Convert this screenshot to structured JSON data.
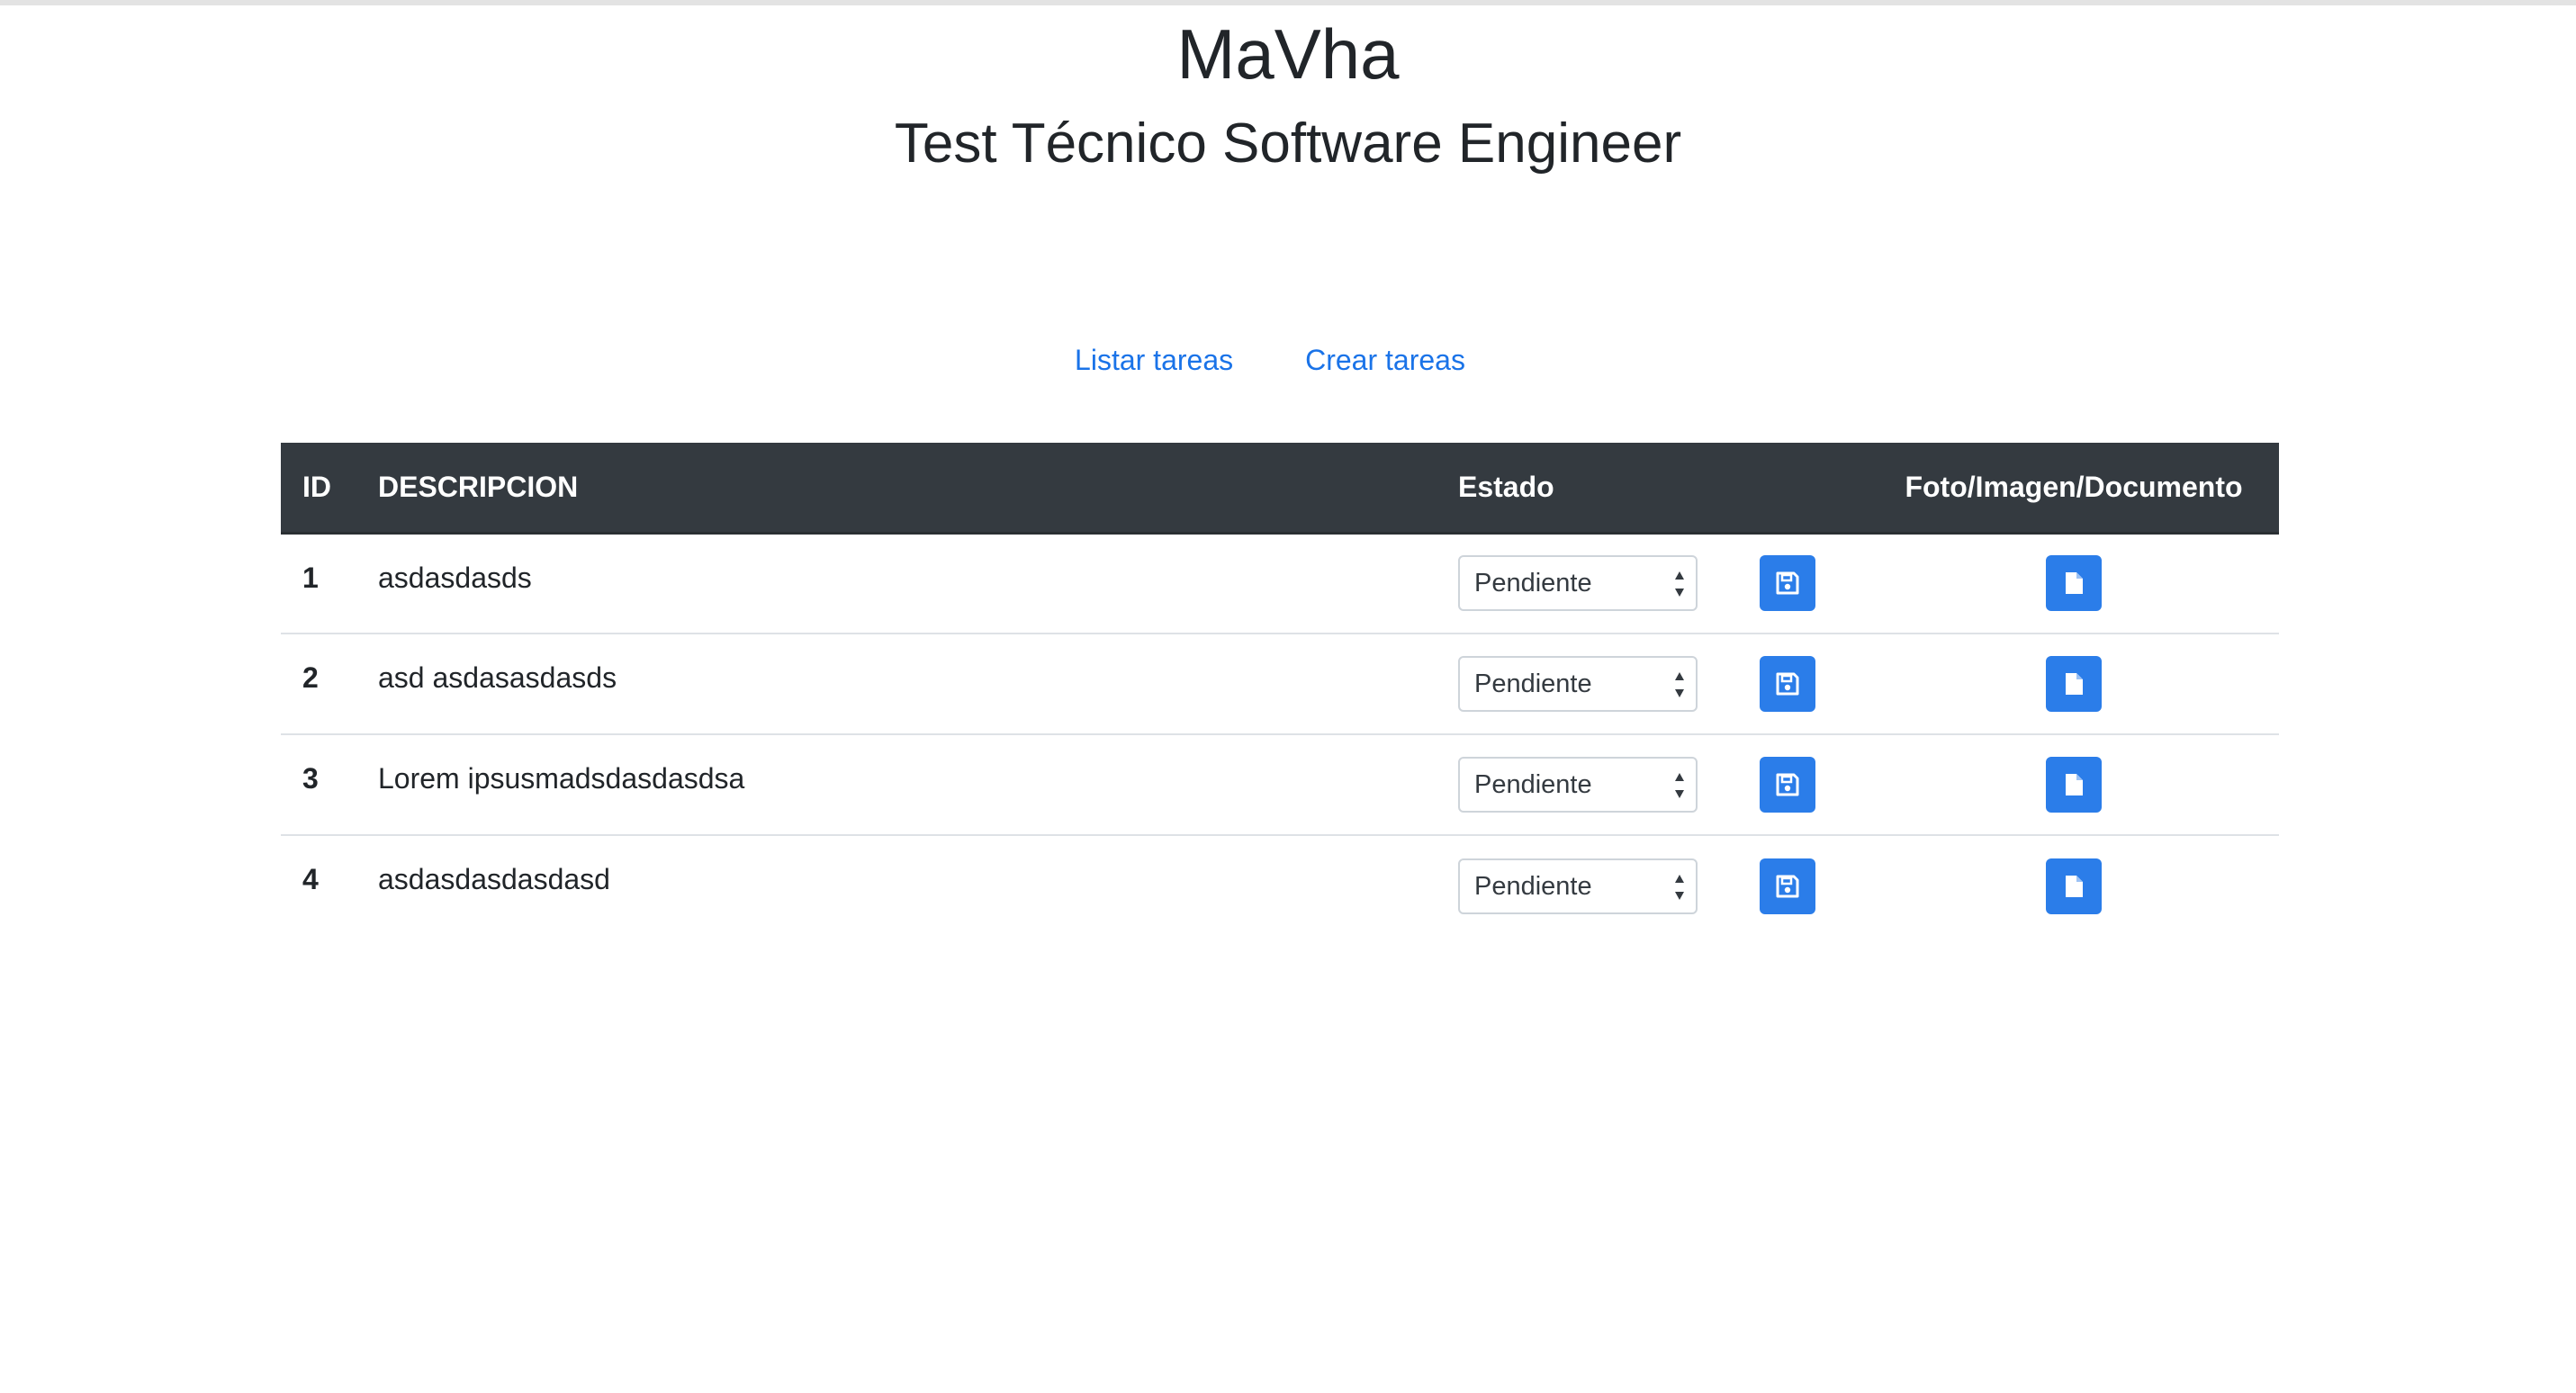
{
  "header": {
    "title": "MaVha",
    "subtitle": "Test Técnico Software Engineer"
  },
  "nav": {
    "list_label": "Listar tareas",
    "create_label": "Crear tareas"
  },
  "table": {
    "columns": {
      "id": "ID",
      "description": "DESCRIPCION",
      "estado": "Estado",
      "file": "Foto/Imagen/Documento"
    },
    "rows": [
      {
        "id": "1",
        "description": "asdasdasds",
        "estado": "Pendiente"
      },
      {
        "id": "2",
        "description": "asd asdasasdasds",
        "estado": "Pendiente"
      },
      {
        "id": "3",
        "description": "Lorem ipsusmadsdasdasdsa",
        "estado": "Pendiente"
      },
      {
        "id": "4",
        "description": "asdasdasdasdasd",
        "estado": "Pendiente"
      }
    ]
  },
  "icons": {
    "save": "floppy-disk-icon",
    "file": "file-icon"
  },
  "colors": {
    "header_bg": "#343a40",
    "link": "#1a73e8",
    "button": "#2b7de9"
  }
}
